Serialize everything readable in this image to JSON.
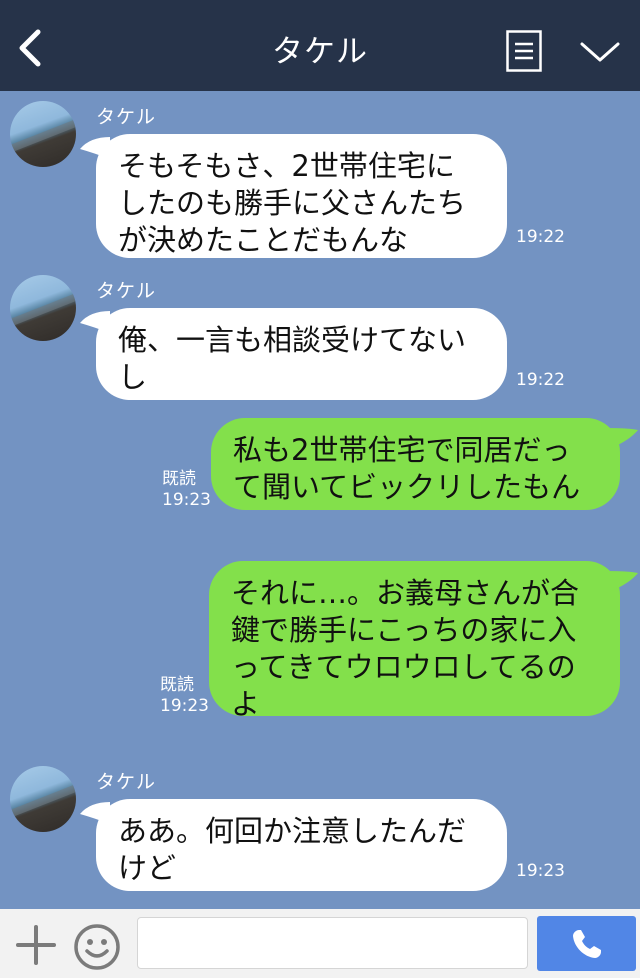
{
  "header": {
    "title": "タケル",
    "back_icon": "chevron-left-icon",
    "menu_icon": "list-icon",
    "collapse_icon": "chevron-down-icon"
  },
  "messages": [
    {
      "side": "in",
      "sender": "タケル",
      "text": "そもそもさ、2世帯住宅に\nしたのも勝手に父さんたち\nが決めたことだもんな",
      "time": "19:22"
    },
    {
      "side": "in",
      "sender": "タケル",
      "text": "俺、一言も相談受けてない\nし",
      "time": "19:22"
    },
    {
      "side": "out",
      "read": "既読",
      "text": "私も2世帯住宅で同居だっ\nて聞いてビックリしたもん",
      "time": "19:23"
    },
    {
      "side": "out",
      "read": "既読",
      "text": "それに…。お義母さんが合\n鍵で勝手にこっちの家に入\nってきてウロウロしてるの\nよ",
      "time": "19:23"
    },
    {
      "side": "in",
      "sender": "タケル",
      "text": "ああ。何回か注意したんだ\nけど",
      "time": "19:23"
    }
  ],
  "footer": {
    "plus_icon": "plus-icon",
    "emoji_icon": "smile-icon",
    "input_value": "",
    "send_icon": "phone-icon"
  },
  "colors": {
    "header_bg": "#263349",
    "chat_bg": "#7393c2",
    "outgoing_bubble": "#83e04b",
    "incoming_bubble": "#ffffff",
    "send_button": "#5186e6"
  }
}
